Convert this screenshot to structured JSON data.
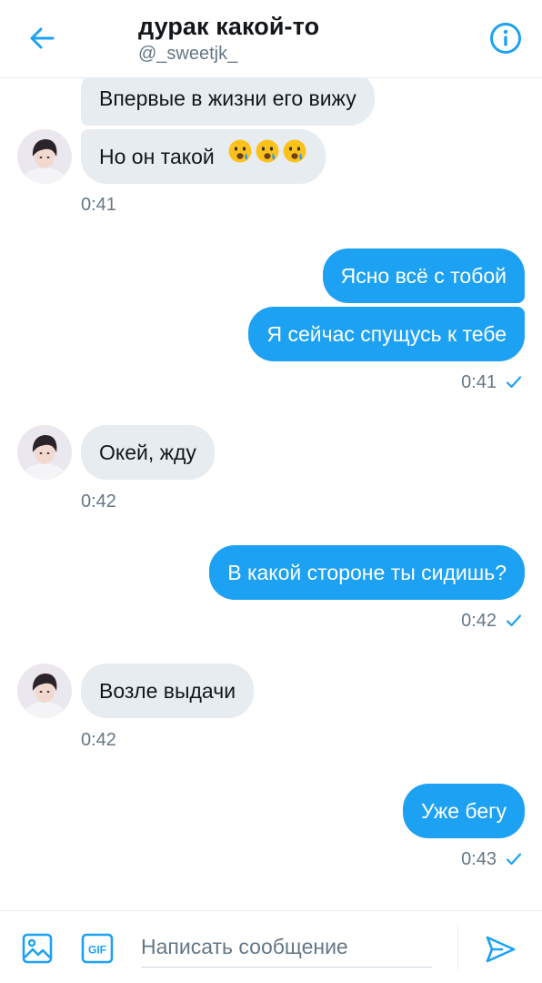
{
  "header": {
    "title": "дурак какой-то",
    "handle": "@_sweetjk_",
    "back_icon": "arrow-left-icon",
    "info_icon": "info-circle-icon"
  },
  "colors": {
    "accent": "#1da1f2",
    "incoming_bubble": "#e6ecf0",
    "secondary_text": "#657786"
  },
  "messages": [
    {
      "direction": "in",
      "text": "Впервые в жизни его вижу"
    },
    {
      "direction": "in",
      "text": "Но он такой",
      "emoji": [
        "crying-face-emoji",
        "crying-face-emoji",
        "crying-face-emoji"
      ]
    },
    {
      "direction": "in",
      "time": "0:41"
    },
    {
      "direction": "out",
      "text": "Ясно всё с тобой"
    },
    {
      "direction": "out",
      "text": "Я сейчас спущусь к тебе"
    },
    {
      "direction": "out",
      "time": "0:41",
      "status": "sent-check-icon"
    },
    {
      "direction": "in",
      "text": "Окей, жду"
    },
    {
      "direction": "in",
      "time": "0:42"
    },
    {
      "direction": "out",
      "text": "В какой стороне ты сидишь?"
    },
    {
      "direction": "out",
      "time": "0:42",
      "status": "sent-check-icon"
    },
    {
      "direction": "in",
      "text": "Возле выдачи"
    },
    {
      "direction": "in",
      "time": "0:42"
    },
    {
      "direction": "out",
      "text": "Уже бегу"
    },
    {
      "direction": "out",
      "time": "0:43",
      "status": "sent-check-icon"
    }
  ],
  "composer": {
    "placeholder": "Написать сообщение",
    "media_icon": "image-icon",
    "gif_label": "GIF",
    "send_icon": "send-icon"
  }
}
